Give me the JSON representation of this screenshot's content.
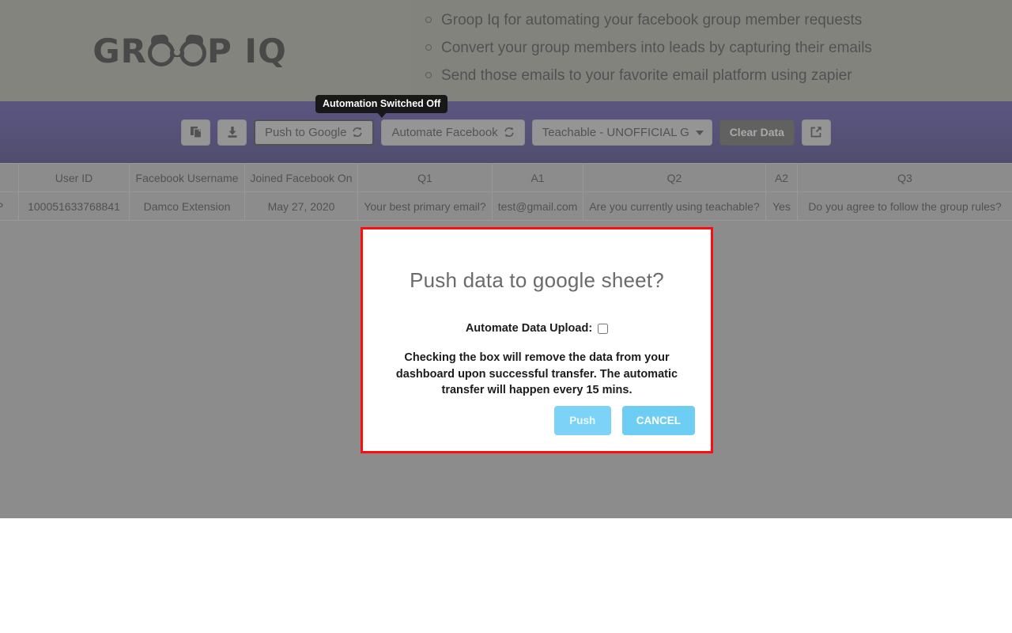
{
  "header": {
    "logo_text_1": "GR",
    "logo_text_2": "P IQ",
    "logo_alt": "Groop IQ",
    "bullets": [
      "Groop Iq for automating your facebook group member requests",
      "Convert your group members into leads by capturing their emails",
      "Send those emails to your favorite email platform using zapier"
    ]
  },
  "tooltip": {
    "text": "Automation Switched Off"
  },
  "toolbar": {
    "copy_icon": "copy-icon",
    "download_icon": "download-icon",
    "push_to_google_label": "Push to Google",
    "push_to_google_icon": "sync-icon",
    "automate_facebook_label": "Automate Facebook",
    "automate_facebook_icon": "sync-icon",
    "group_select_value": "Teachable - UNOFFICIAL GROU",
    "group_select_options": [
      "Teachable - UNOFFICIAL GROU"
    ],
    "clear_data_label": "Clear Data",
    "open_external_icon": "external-link-icon"
  },
  "table": {
    "columns": [
      "",
      "User ID",
      "Facebook Username",
      "Joined Facebook On",
      "Q1",
      "A1",
      "Q2",
      "A2",
      "Q3"
    ],
    "rows": [
      [
        "P",
        "100051633768841",
        "Damco Extension",
        "May 27, 2020",
        "Your best primary email?",
        "test@gmail.com",
        "Are you currently using teachable?",
        "Yes",
        "Do you agree to follow the group rules?"
      ]
    ]
  },
  "modal": {
    "title": "Push data to google sheet?",
    "checkbox_label": "Automate Data Upload:",
    "checkbox_checked": false,
    "description": "Checking the box will remove the data from your dashboard upon successful transfer. The automatic transfer will happen every 15 mins.",
    "push_label": "Push",
    "cancel_label": "CANCEL"
  },
  "colors": {
    "navbar_top": "#2b2180",
    "navbar_bottom": "#161055",
    "header_bg": "#85857a",
    "modal_border": "#fd0d0d",
    "button_blue": "#6ecdf2",
    "overlay": "#999999"
  }
}
